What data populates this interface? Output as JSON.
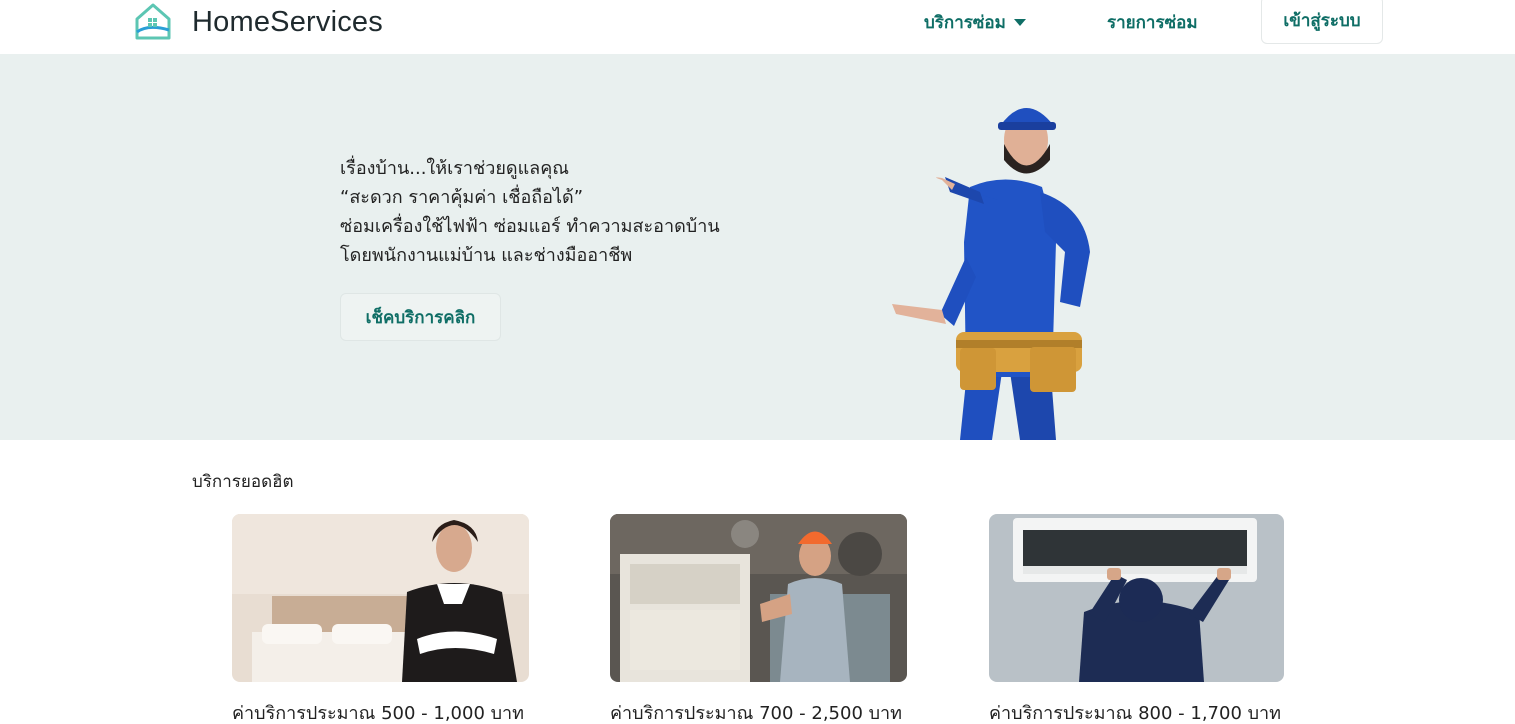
{
  "navbar": {
    "brand": "HomeServices",
    "logo_icon": "house-logo-icon",
    "services_label": "บริการซ่อม",
    "repair_list_label": "รายการซ่อม",
    "login_label": "เข้าสู่ระบบ"
  },
  "hero": {
    "lines": [
      "เรื่องบ้าน...ให้เราช่วยดูแลคุณ",
      "“สะดวก ราคาคุ้มค่า เชื่อถือได้”",
      "ซ่อมเครื่องใช้ไฟฟ้า ซ่อมแอร์ ทำความสะอาดบ้าน",
      "โดยพนักงานแม่บ้าน และช่างมืออาชีพ"
    ],
    "cta_label": "เช็คบริการคลิก"
  },
  "popular": {
    "title": "บริการยอดฮิต",
    "cards": [
      {
        "price": "ค่าบริการประมาณ 500 - 1,000 บาท"
      },
      {
        "price": "ค่าบริการประมาณ 700 - 2,500 บาท"
      },
      {
        "price": "ค่าบริการประมาณ 800 - 1,700 บาท"
      }
    ]
  },
  "colors": {
    "accent": "#0f6e66",
    "hero_bg": "#e9f0ef",
    "worker_uniform": "#1f4fbf"
  }
}
